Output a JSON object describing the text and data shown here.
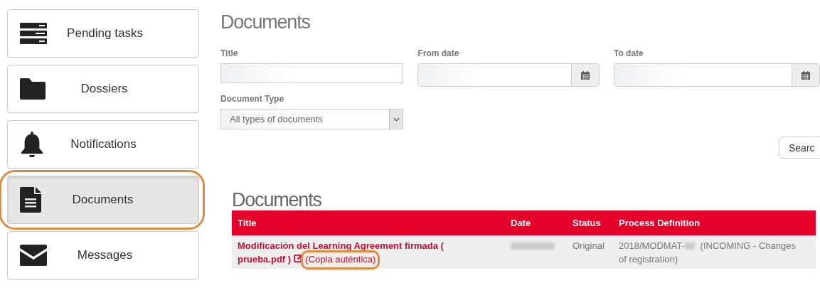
{
  "sidebar": {
    "items": [
      {
        "label": "Pending tasks",
        "selected": false,
        "highlighted": false
      },
      {
        "label": "Dossiers",
        "selected": false,
        "highlighted": false
      },
      {
        "label": "Notifications",
        "selected": false,
        "highlighted": false
      },
      {
        "label": "Documents",
        "selected": true,
        "highlighted": true
      },
      {
        "label": "Messages",
        "selected": false,
        "highlighted": false
      }
    ]
  },
  "page_title": "Documents",
  "filters": {
    "title": {
      "label": "Title"
    },
    "from_date": {
      "label": "From date"
    },
    "to_date": {
      "label": "To date"
    },
    "document_type": {
      "label": "Document Type",
      "value": "All types of documents"
    },
    "search_button": "Searc"
  },
  "results": {
    "title": "Documents",
    "columns": [
      "Title",
      "Date",
      "Status",
      "Process Definition"
    ],
    "rows": [
      {
        "title_lines": [
          "Modificación del Learning Agreement firmada (",
          "prueba.pdf )"
        ],
        "copy_link": "(Copia auténtica)",
        "copy_link_highlighted": true,
        "date_redacted": true,
        "status": "Original",
        "process_prefix": "2018/MODMAT-",
        "process_redacted": true,
        "process_lines": [
          "(INCOMING - Changes",
          "of registration)"
        ]
      }
    ]
  }
}
